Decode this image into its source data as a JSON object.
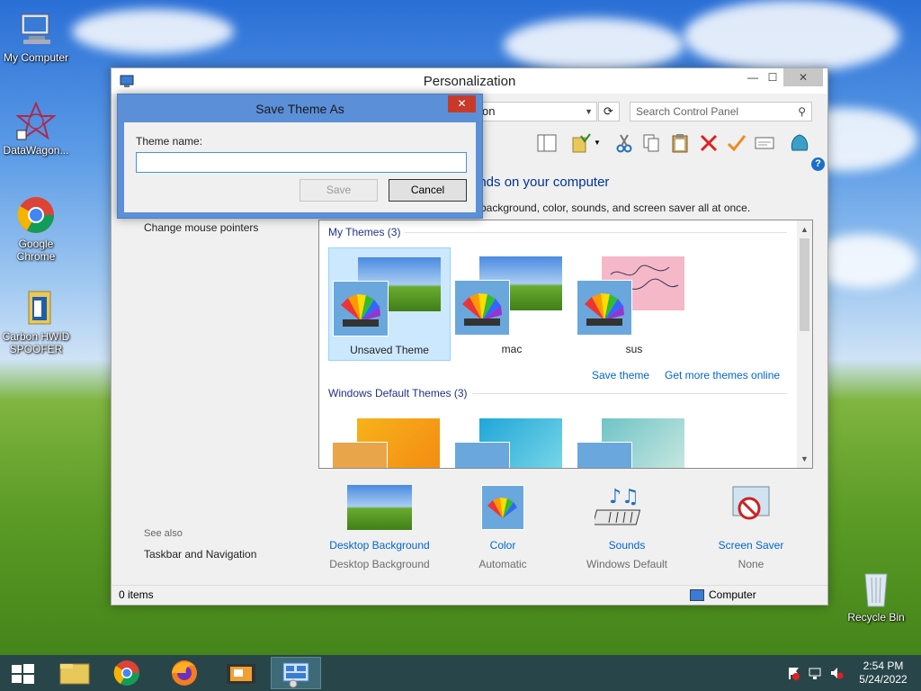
{
  "desktop": {
    "icons": [
      {
        "label": "My Computer"
      },
      {
        "label": "DataWagon..."
      },
      {
        "label": "Google Chrome"
      },
      {
        "label": "Carbon HWID SPOOFER"
      },
      {
        "label": "Recycle Bin"
      }
    ]
  },
  "window": {
    "title": "Personalization",
    "controls": {
      "minimize": "—",
      "maximize": "☐",
      "close": "✕"
    },
    "address_text": "on",
    "search": {
      "placeholder": "Search Control Panel"
    },
    "heading": "unds on your computer",
    "subheading": "p background, color, sounds, and screen saver all at once.",
    "left_links": [
      {
        "label": "Change mouse pointers"
      }
    ],
    "see_also": {
      "title": "See also",
      "links": [
        {
          "label": "Taskbar and Navigation"
        }
      ]
    },
    "themes": {
      "my_themes_header": "My Themes (3)",
      "my_themes": [
        {
          "name": "Unsaved Theme",
          "selected": true
        },
        {
          "name": "mac",
          "selected": false
        },
        {
          "name": "sus",
          "selected": false
        }
      ],
      "save_theme_link": "Save theme",
      "get_more_link": "Get more themes online",
      "default_header": "Windows Default Themes (3)"
    },
    "bottom": [
      {
        "label": "Desktop Background",
        "value": "Desktop Background"
      },
      {
        "label": "Color",
        "value": "Automatic"
      },
      {
        "label": "Sounds",
        "value": "Windows Default"
      },
      {
        "label": "Screen Saver",
        "value": "None"
      }
    ],
    "status": {
      "items_count": "0 items",
      "location": "Computer"
    }
  },
  "dialog": {
    "title": "Save Theme As",
    "close": "✕",
    "label": "Theme name:",
    "input_value": "",
    "save_button": "Save",
    "cancel_button": "Cancel"
  },
  "taskbar": {
    "time": "2:54 PM",
    "date": "5/24/2022"
  },
  "colors": {
    "accent": "#5b8fd8",
    "link": "#0066cc",
    "taskbar": "#28464a",
    "close_red": "#c73a2a"
  }
}
